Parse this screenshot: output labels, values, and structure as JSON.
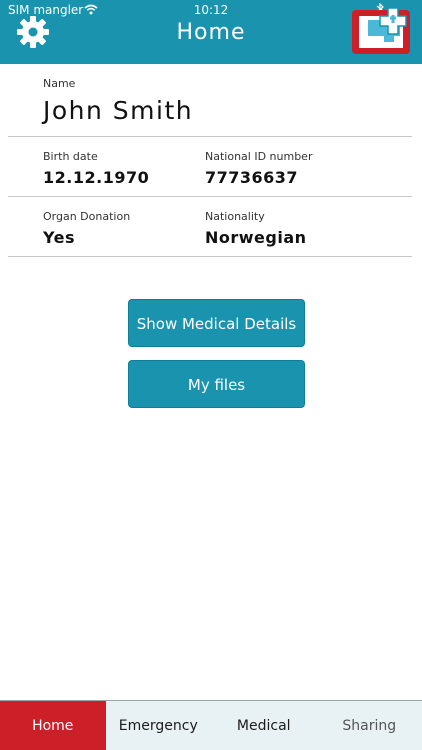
{
  "status_bar": {
    "carrier": "SIM mangler",
    "time": "10:12"
  },
  "header": {
    "title": "Home"
  },
  "profile": {
    "name_label": "Name",
    "name_value": "John Smith",
    "birth_label": "Birth date",
    "birth_value": "12.12.1970",
    "id_label": "National ID number",
    "id_value": "77736637",
    "organ_label": "Organ Donation",
    "organ_value": "Yes",
    "nationality_label": "Nationality",
    "nationality_value": "Norwegian"
  },
  "actions": {
    "medical_details_label": "Show Medical Details",
    "files_label": "My files"
  },
  "tabs": [
    {
      "label": "Home"
    },
    {
      "label": "Emergency"
    },
    {
      "label": "Medical"
    },
    {
      "label": "Sharing"
    }
  ],
  "colors": {
    "header": "#1a94ae",
    "active_tab": "#cc1f27",
    "button": "#1a94ae",
    "inactive_tab": "#e8f1f4"
  },
  "icons": [
    "wifi-icon",
    "bluetooth-icon",
    "gear-icon",
    "app-logo-icon"
  ]
}
